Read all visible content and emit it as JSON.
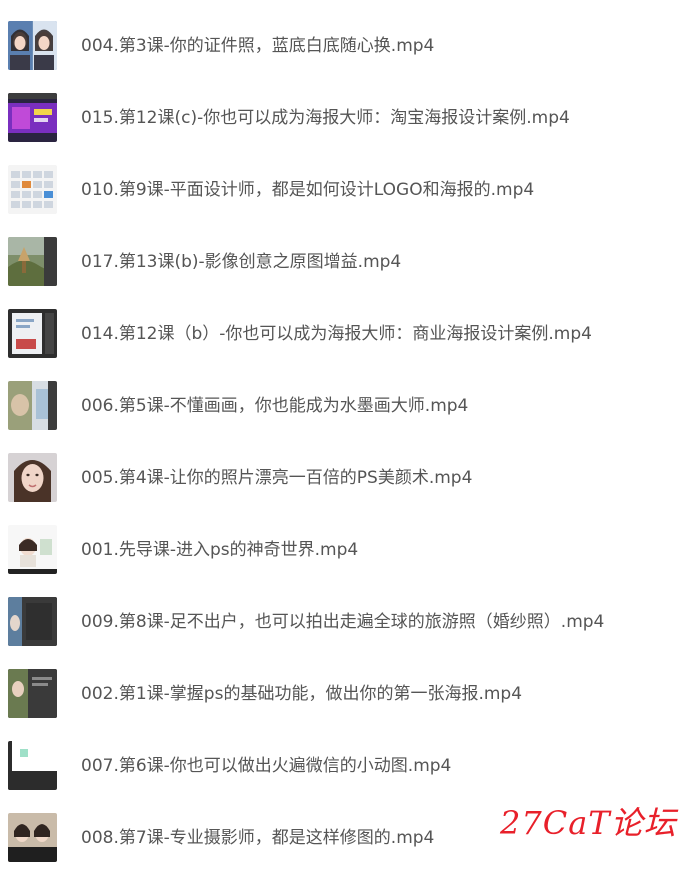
{
  "files": [
    {
      "name": "004.第3课-你的证件照，蓝底白底随心换.mp4",
      "thumbnail": "id-photo-thumbnail"
    },
    {
      "name": "015.第12课(c)-你也可以成为海报大师：淘宝海报设计案例.mp4",
      "thumbnail": "purple-poster-thumbnail"
    },
    {
      "name": "010.第9课-平面设计师，都是如何设计LOGO和海报的.mp4",
      "thumbnail": "logo-grid-thumbnail"
    },
    {
      "name": "017.第13课(b)-影像创意之原图增益.mp4",
      "thumbnail": "landscape-thumbnail"
    },
    {
      "name": "014.第12课（b）-你也可以成为海报大师：商业海报设计案例.mp4",
      "thumbnail": "software-ui-thumbnail"
    },
    {
      "name": "006.第5课-不懂画画，你也能成为水墨画大师.mp4",
      "thumbnail": "ink-painting-thumbnail"
    },
    {
      "name": "005.第4课-让你的照片漂亮一百倍的PS美颜术.mp4",
      "thumbnail": "portrait-thumbnail"
    },
    {
      "name": "001.先导课-进入ps的神奇世界.mp4",
      "thumbnail": "intro-thumbnail"
    },
    {
      "name": "009.第8课-足不出户，也可以拍出走遍全球的旅游照（婚纱照）.mp4",
      "thumbnail": "travel-photo-thumbnail"
    },
    {
      "name": "002.第1课-掌握ps的基础功能，做出你的第一张海报.mp4",
      "thumbnail": "basic-poster-thumbnail"
    },
    {
      "name": "007.第6课-你也可以做出火遍微信的小动图.mp4",
      "thumbnail": "animated-gif-thumbnail"
    },
    {
      "name": "008.第7课-专业摄影师，都是这样修图的.mp4",
      "thumbnail": "retouch-thumbnail"
    }
  ],
  "watermark": "27CaT论坛",
  "colors": {
    "text": "#555555",
    "watermark": "#e8202a",
    "background": "#ffffff"
  }
}
